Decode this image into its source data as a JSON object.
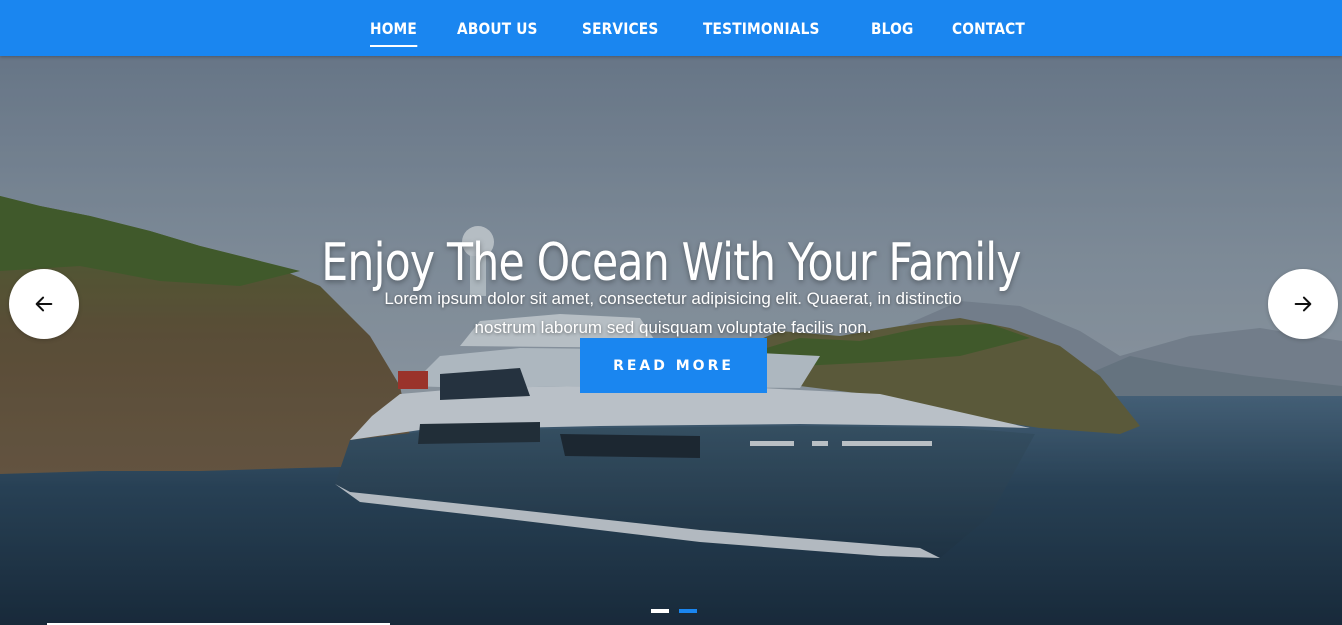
{
  "nav": {
    "items": [
      {
        "label": "HOME",
        "active": true
      },
      {
        "label": "ABOUT US",
        "active": false
      },
      {
        "label": "SERVICES",
        "active": false
      },
      {
        "label": "TESTIMONIALS",
        "active": false
      },
      {
        "label": "BLOG",
        "active": false
      },
      {
        "label": "CONTACT",
        "active": false
      }
    ]
  },
  "hero": {
    "title": "Enjoy The Ocean With Your Family",
    "text": "Lorem ipsum dolor sit amet, consectetur adipisicing elit. Quaerat, in distinctio nostrum laborum sed quisquam voluptate facilis non.",
    "button_label": "READ MORE",
    "prev_icon": "arrow-left-icon",
    "next_icon": "arrow-right-icon",
    "slides_total": 2,
    "active_slide": 2
  },
  "colors": {
    "accent": "#1a86f0",
    "text": "#ffffff"
  }
}
